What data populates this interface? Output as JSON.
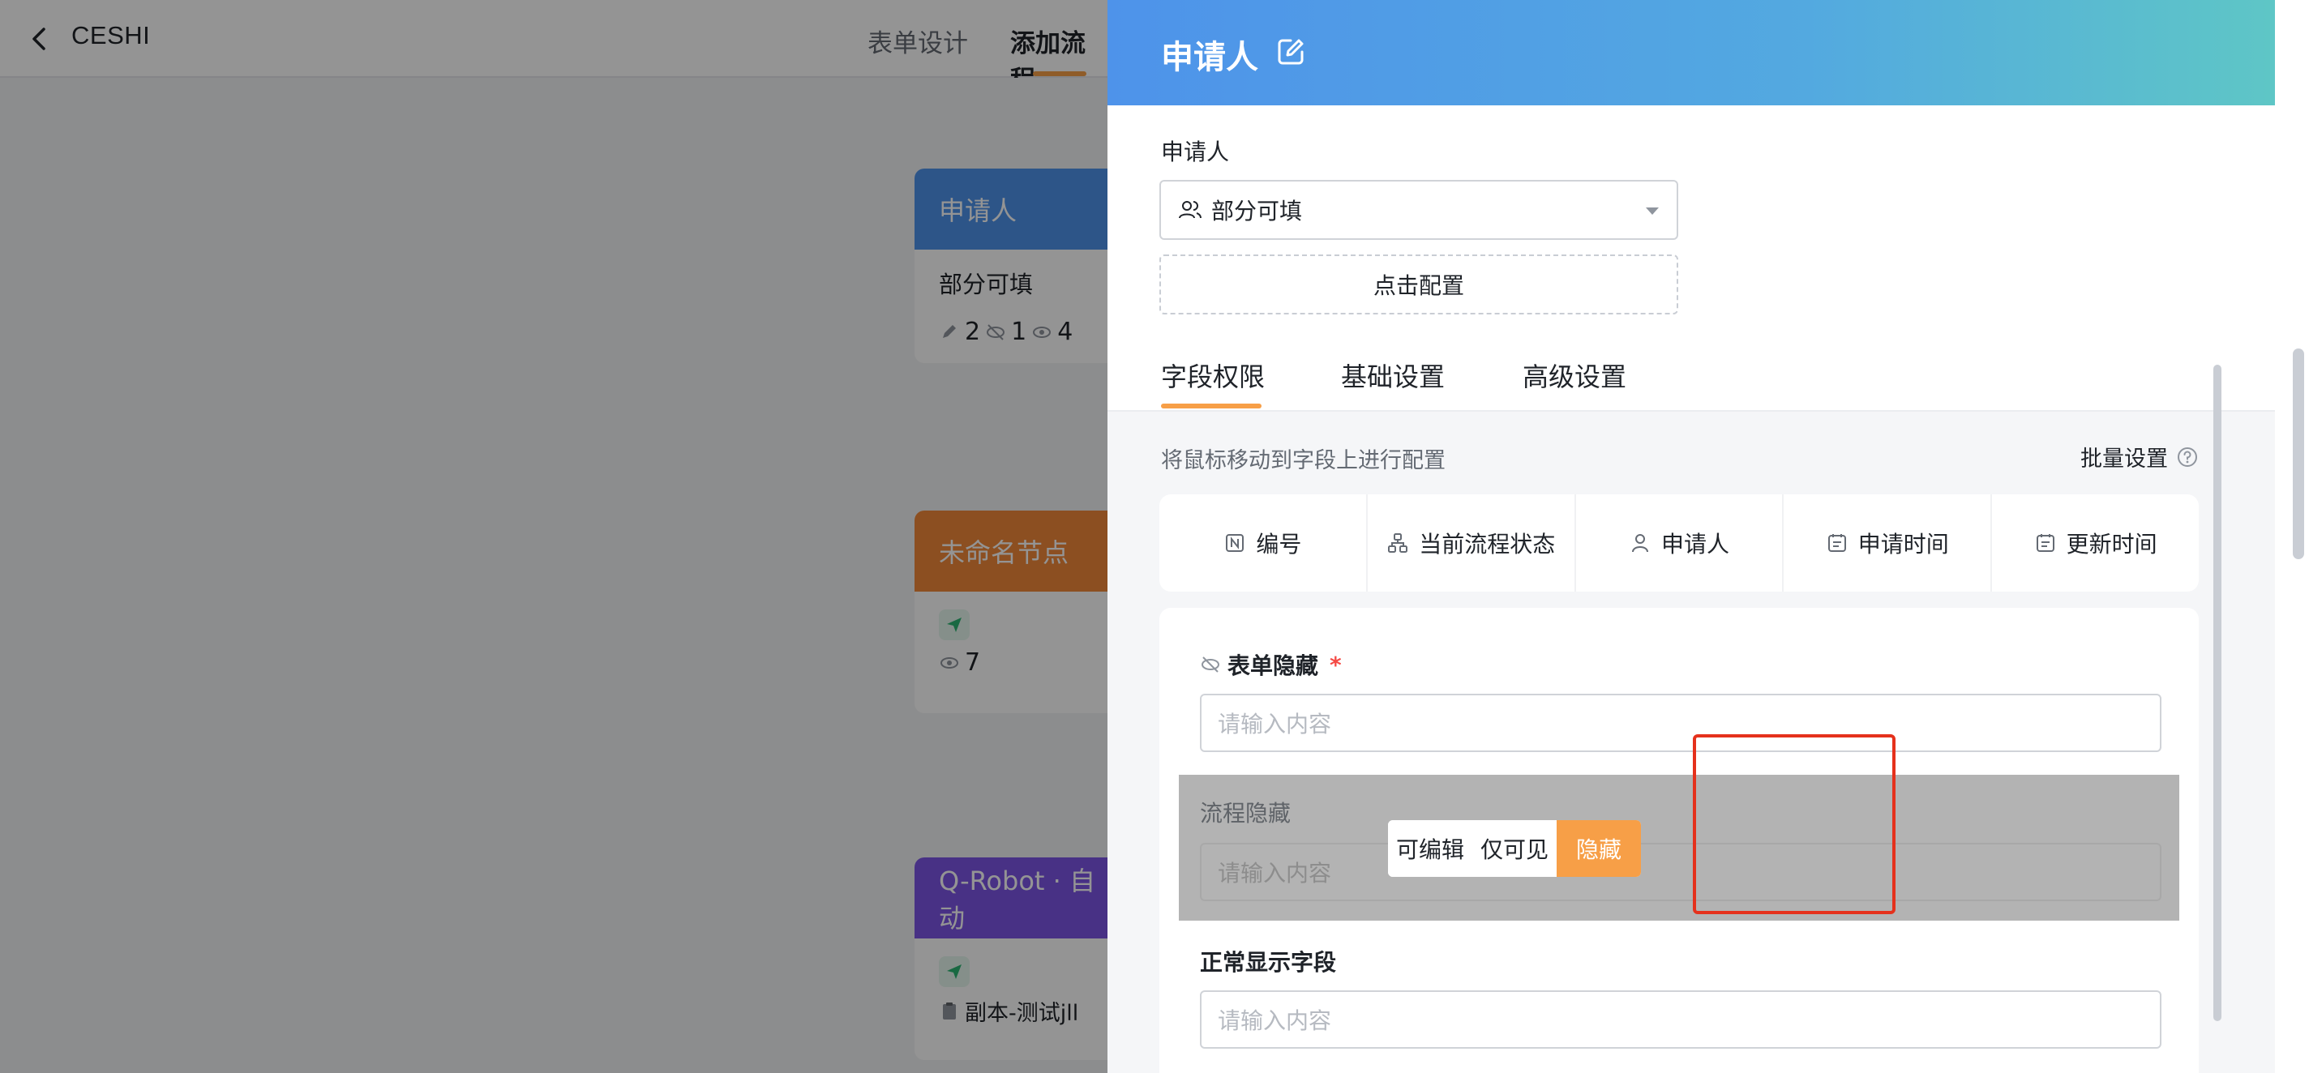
{
  "app": {
    "title": "CESHI",
    "tabs": [
      "表单设计",
      "添加流程"
    ]
  },
  "canvas": {
    "nodes": [
      {
        "title": "申请人",
        "subtitle": "部分可填",
        "stats": {
          "edit": "2",
          "hidden": "1",
          "visible": "4"
        }
      },
      {
        "title": "未命名节点",
        "visible": "7"
      },
      {
        "title": "Q-Robot · 自动",
        "item": "副本-测试jll"
      }
    ]
  },
  "drawer": {
    "title": "申请人",
    "section_label": "申请人",
    "permission_select": "部分可填",
    "config_button": "点击配置",
    "tabs": [
      "字段权限",
      "基础设置",
      "高级设置"
    ],
    "hint": "将鼠标移动到字段上进行配置",
    "batch_label": "批量设置",
    "system_fields": [
      "编号",
      "当前流程状态",
      "申请人",
      "申请时间",
      "更新时间"
    ],
    "fields": [
      {
        "label": "表单隐藏",
        "required": "*",
        "placeholder": "请输入内容"
      },
      {
        "label": "流程隐藏",
        "placeholder": "请输入内容"
      },
      {
        "label": "正常显示字段",
        "placeholder": "请输入内容"
      }
    ],
    "permission_options": [
      "可编辑",
      "仅可见",
      "隐藏"
    ],
    "permission_selected": "隐藏"
  },
  "colors": {
    "accent": "#f79f47",
    "header_gradient_start": "#4e93ea",
    "header_gradient_end": "#5ec6c6",
    "highlight": "#e5311c"
  }
}
